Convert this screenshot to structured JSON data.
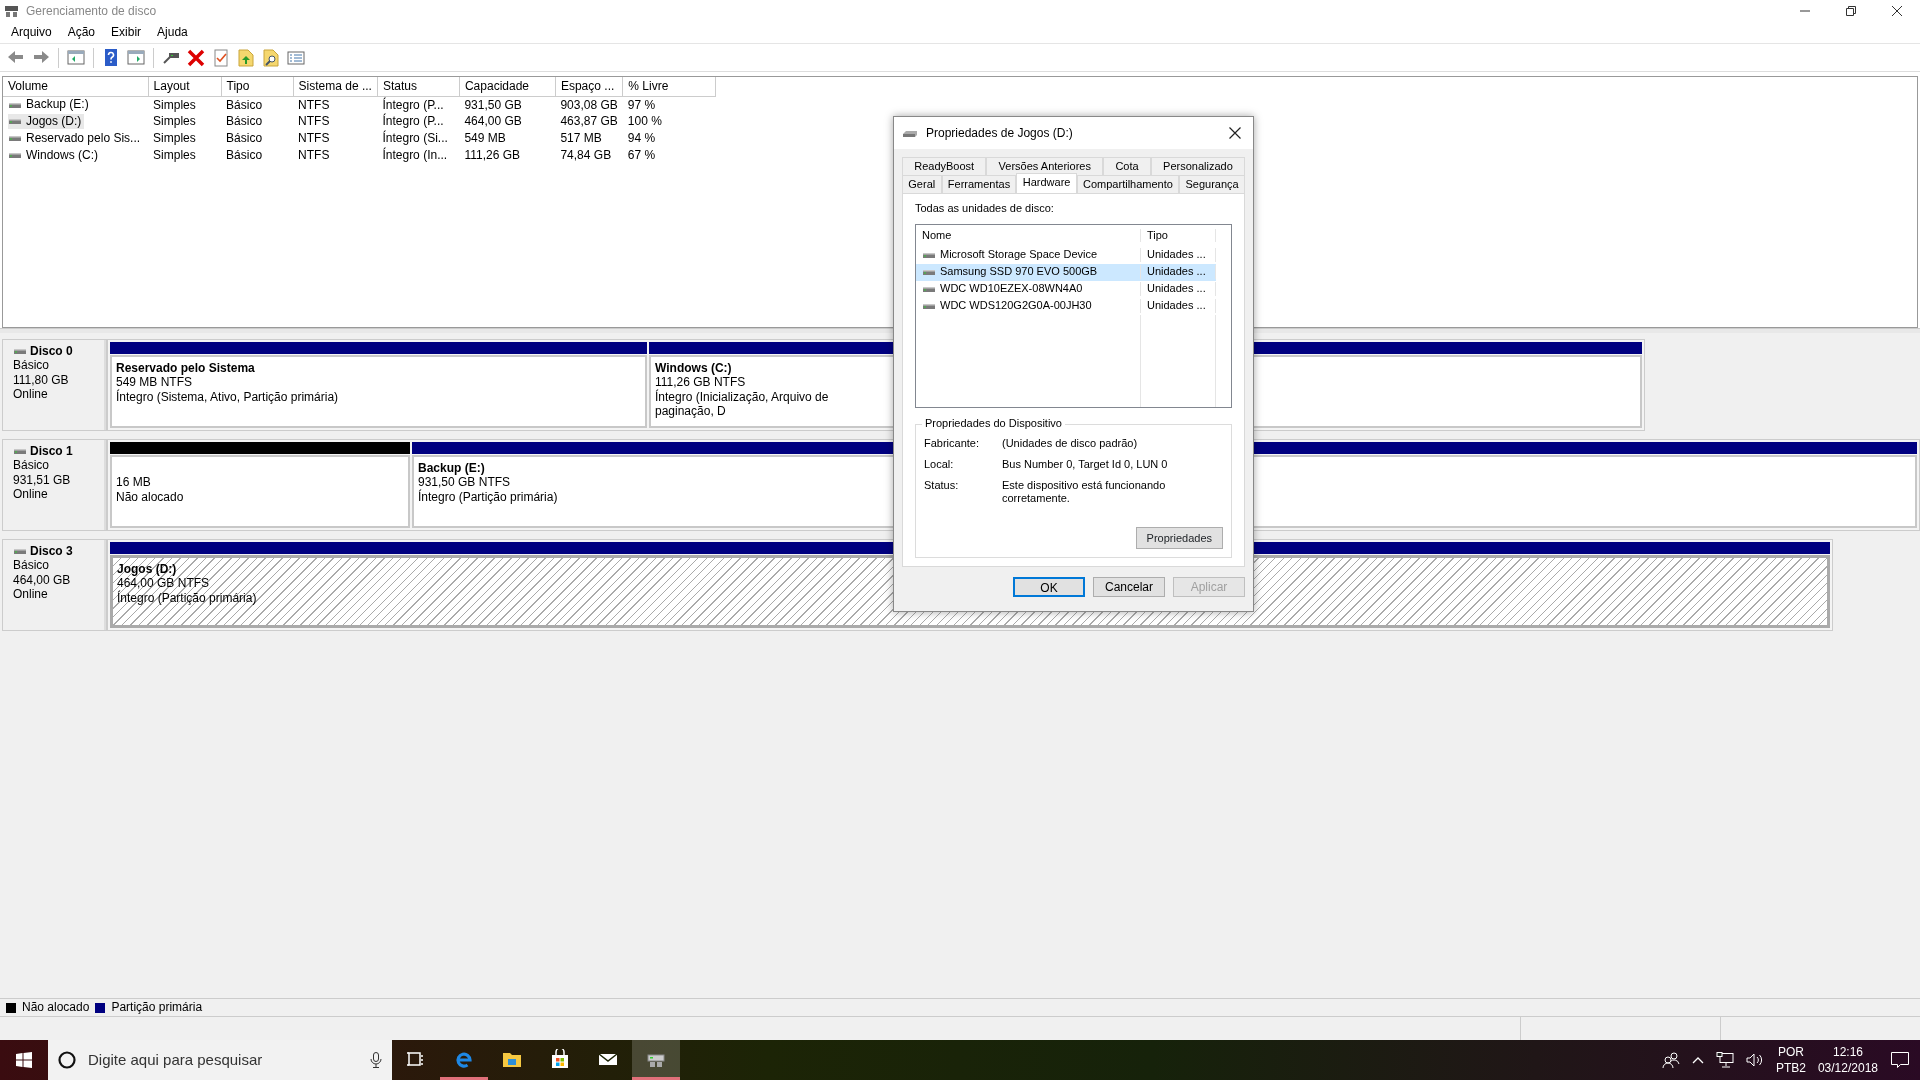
{
  "window": {
    "title": "Gerenciamento de disco"
  },
  "menu": [
    "Arquivo",
    "Ação",
    "Exibir",
    "Ajuda"
  ],
  "volumes": {
    "columns": [
      "Volume",
      "Layout",
      "Tipo",
      "Sistema de ...",
      "Status",
      "Capacidade",
      "Espaço ...",
      "% Livre"
    ],
    "rows": [
      {
        "selected": false,
        "cells": [
          "Backup (E:)",
          "Simples",
          "Básico",
          "NTFS",
          "Íntegro (P...",
          "931,50 GB",
          "903,08 GB",
          "97 %"
        ]
      },
      {
        "selected": true,
        "cells": [
          "Jogos (D:)",
          "Simples",
          "Básico",
          "NTFS",
          "Íntegro (P...",
          "464,00 GB",
          "463,87 GB",
          "100 %"
        ]
      },
      {
        "selected": false,
        "cells": [
          "Reservado pelo Sis...",
          "Simples",
          "Básico",
          "NTFS",
          "Íntegro (Si...",
          "549 MB",
          "517 MB",
          "94 %"
        ]
      },
      {
        "selected": false,
        "cells": [
          "Windows (C:)",
          "Simples",
          "Básico",
          "NTFS",
          "Íntegro (In...",
          "111,26 GB",
          "74,84 GB",
          "67 %"
        ]
      }
    ]
  },
  "disks": [
    {
      "name": "Disco 0",
      "type": "Básico",
      "size": "111,80 GB",
      "status": "Online",
      "partitions": [
        {
          "kind": "primary",
          "selected": false,
          "name": "Reservado pelo Sistema",
          "size": "549 MB NTFS",
          "status": "Íntegro (Sistema, Ativo, Partição primária)"
        },
        {
          "kind": "primary",
          "selected": false,
          "name": "Windows  (C:)",
          "size": "111,26 GB NTFS",
          "status": "Íntegro (Inicialização, Arquivo de paginação, D"
        }
      ]
    },
    {
      "name": "Disco 1",
      "type": "Básico",
      "size": "931,51 GB",
      "status": "Online",
      "partitions": [
        {
          "kind": "unallocated",
          "selected": false,
          "size": "16 MB",
          "status": "Não alocado"
        },
        {
          "kind": "primary",
          "selected": false,
          "name": "Backup  (E:)",
          "size": "931,50 GB NTFS",
          "status": "Íntegro (Partição primária)"
        }
      ]
    },
    {
      "name": "Disco 3",
      "type": "Básico",
      "size": "464,00 GB",
      "status": "Online",
      "partitions": [
        {
          "kind": "primary",
          "selected": true,
          "name": "Jogos  (D:)",
          "size": "464,00 GB NTFS",
          "status": "Íntegro (Partição primária)"
        }
      ]
    }
  ],
  "legend": [
    {
      "label": "Não alocado",
      "color": "#000000"
    },
    {
      "label": "Partição primária",
      "color": "#000080"
    }
  ],
  "dialog": {
    "title": "Propriedades de Jogos (D:)",
    "tab_rows": [
      {
        "tabs": [
          {
            "label": "ReadyBoost",
            "selected": false
          },
          {
            "label": "Versões Anteriores",
            "selected": false
          },
          {
            "label": "Cota",
            "selected": false
          },
          {
            "label": "Personalizado",
            "selected": false
          }
        ]
      },
      {
        "tabs": [
          {
            "label": "Geral",
            "selected": false
          },
          {
            "label": "Ferramentas",
            "selected": false
          },
          {
            "label": "Hardware",
            "selected": true
          },
          {
            "label": "Compartilhamento",
            "selected": false
          },
          {
            "label": "Segurança",
            "selected": false
          }
        ]
      }
    ],
    "list_label": "Todas as unidades de disco:",
    "drives": {
      "columns": [
        "Nome",
        "Tipo"
      ],
      "rows": [
        {
          "name": "Microsoft Storage Space Device",
          "type": "Unidades ...",
          "selected": false
        },
        {
          "name": "Samsung SSD 970 EVO 500GB",
          "type": "Unidades ...",
          "selected": true
        },
        {
          "name": "WDC WD10EZEX-08WN4A0",
          "type": "Unidades ...",
          "selected": false
        },
        {
          "name": "WDC WDS120G2G0A-00JH30",
          "type": "Unidades ...",
          "selected": false
        }
      ]
    },
    "device_group": {
      "title": "Propriedades do Dispositivo",
      "fields": [
        {
          "label": "Fabricante:",
          "value": "(Unidades de disco padrão)"
        },
        {
          "label": "Local:",
          "value": "Bus Number 0, Target Id 0, LUN 0"
        },
        {
          "label": "Status:",
          "value": "Este dispositivo está funcionando corretamente."
        }
      ],
      "button": "Propriedades"
    },
    "buttons": [
      {
        "label": "OK",
        "default": true,
        "disabled": false
      },
      {
        "label": "Cancelar",
        "default": false,
        "disabled": false
      },
      {
        "label": "Aplicar",
        "default": false,
        "disabled": true
      }
    ]
  },
  "taskbar": {
    "search": {
      "placeholder": "Digite aqui para pesquisar"
    },
    "apps": [
      {
        "kind": "task-view",
        "running": false,
        "active": false
      },
      {
        "kind": "edge",
        "running": true,
        "active": false
      },
      {
        "kind": "explorer",
        "running": false,
        "active": false
      },
      {
        "kind": "store",
        "running": false,
        "active": false
      },
      {
        "kind": "mail",
        "running": false,
        "active": false
      },
      {
        "kind": "disk-manager",
        "running": true,
        "active": true
      }
    ],
    "tray": {
      "language": "POR",
      "layout": "PTB2",
      "time": "12:16",
      "date": "03/12/2018"
    }
  }
}
